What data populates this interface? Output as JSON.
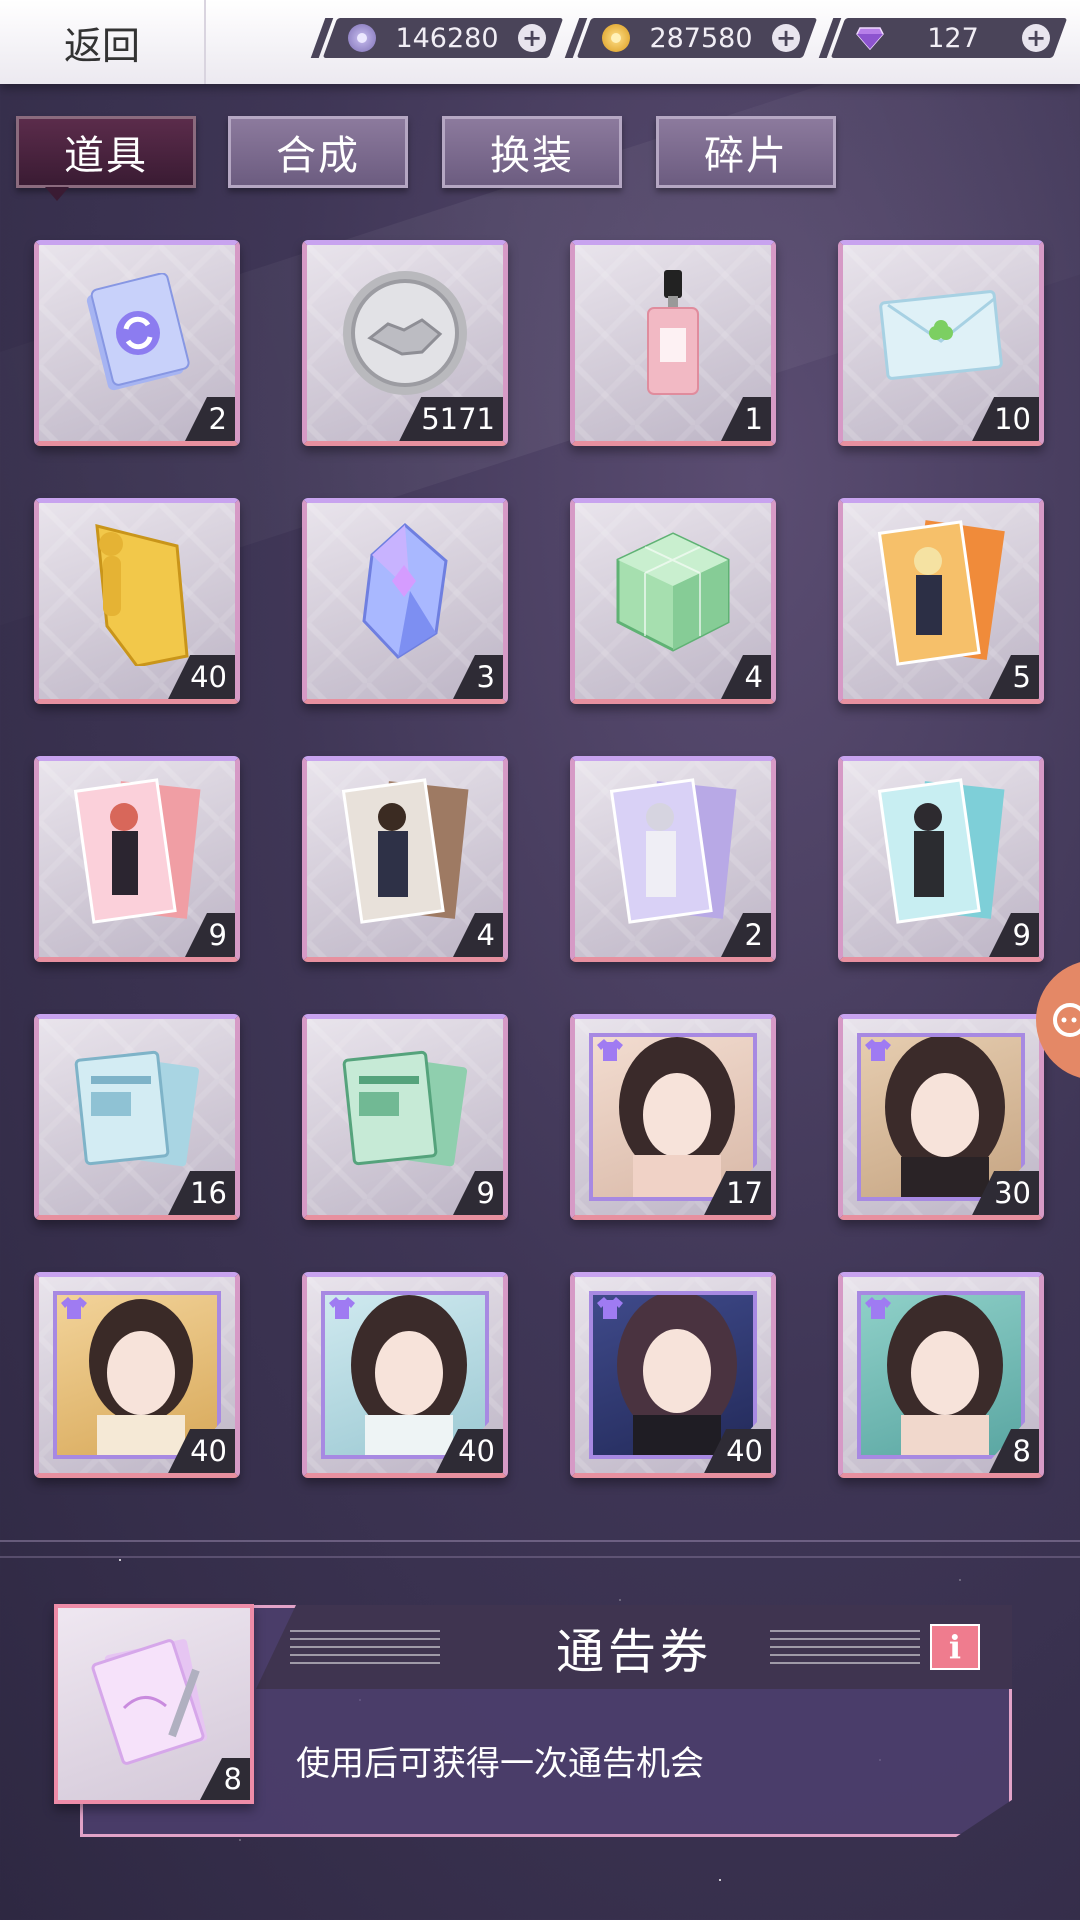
{
  "header": {
    "back_label": "返回",
    "currencies": [
      {
        "name": "silver-coin",
        "value": "146280"
      },
      {
        "name": "gold-coin",
        "value": "287580"
      },
      {
        "name": "diamond",
        "value": "127"
      }
    ]
  },
  "tabs": [
    {
      "label": "道具",
      "active": true
    },
    {
      "label": "合成",
      "active": false
    },
    {
      "label": "换装",
      "active": false
    },
    {
      "label": "碎片",
      "active": false
    }
  ],
  "items": [
    {
      "icon": "program-demand-card-icon",
      "count": "2"
    },
    {
      "icon": "handshake-coin-icon",
      "count": "5171"
    },
    {
      "icon": "perfume-bottle-icon",
      "count": "1"
    },
    {
      "icon": "clover-envelope-icon",
      "count": "10"
    },
    {
      "icon": "golden-trophy-icon",
      "count": "40"
    },
    {
      "icon": "blue-crystal-icon",
      "count": "3"
    },
    {
      "icon": "green-cube-icon",
      "count": "4"
    },
    {
      "icon": "character-card-orange-icon",
      "count": "5"
    },
    {
      "icon": "character-card-pink-icon",
      "count": "9"
    },
    {
      "icon": "character-card-brown-icon",
      "count": "4"
    },
    {
      "icon": "character-card-purple-icon",
      "count": "2"
    },
    {
      "icon": "character-card-cyan-icon",
      "count": "9"
    },
    {
      "icon": "curriculum-book-blue-icon",
      "count": "16"
    },
    {
      "icon": "curriculum-book-green-icon",
      "count": "9"
    },
    {
      "icon": "outfit-portrait-icon",
      "count": "17"
    },
    {
      "icon": "outfit-portrait-icon",
      "count": "30"
    },
    {
      "icon": "outfit-portrait-icon",
      "count": "40"
    },
    {
      "icon": "outfit-portrait-icon",
      "count": "40"
    },
    {
      "icon": "outfit-portrait-icon",
      "count": "40"
    },
    {
      "icon": "outfit-portrait-icon",
      "count": "8"
    }
  ],
  "detail": {
    "title": "通告券",
    "description": "使用后可获得一次通告机会",
    "count": "8",
    "info_label": "i"
  },
  "colors": {
    "accent_pink": "#e7909f",
    "accent_purple": "#c8a3ef",
    "tab_active": "#3a1b33",
    "info_button": "#ef7c8e"
  }
}
